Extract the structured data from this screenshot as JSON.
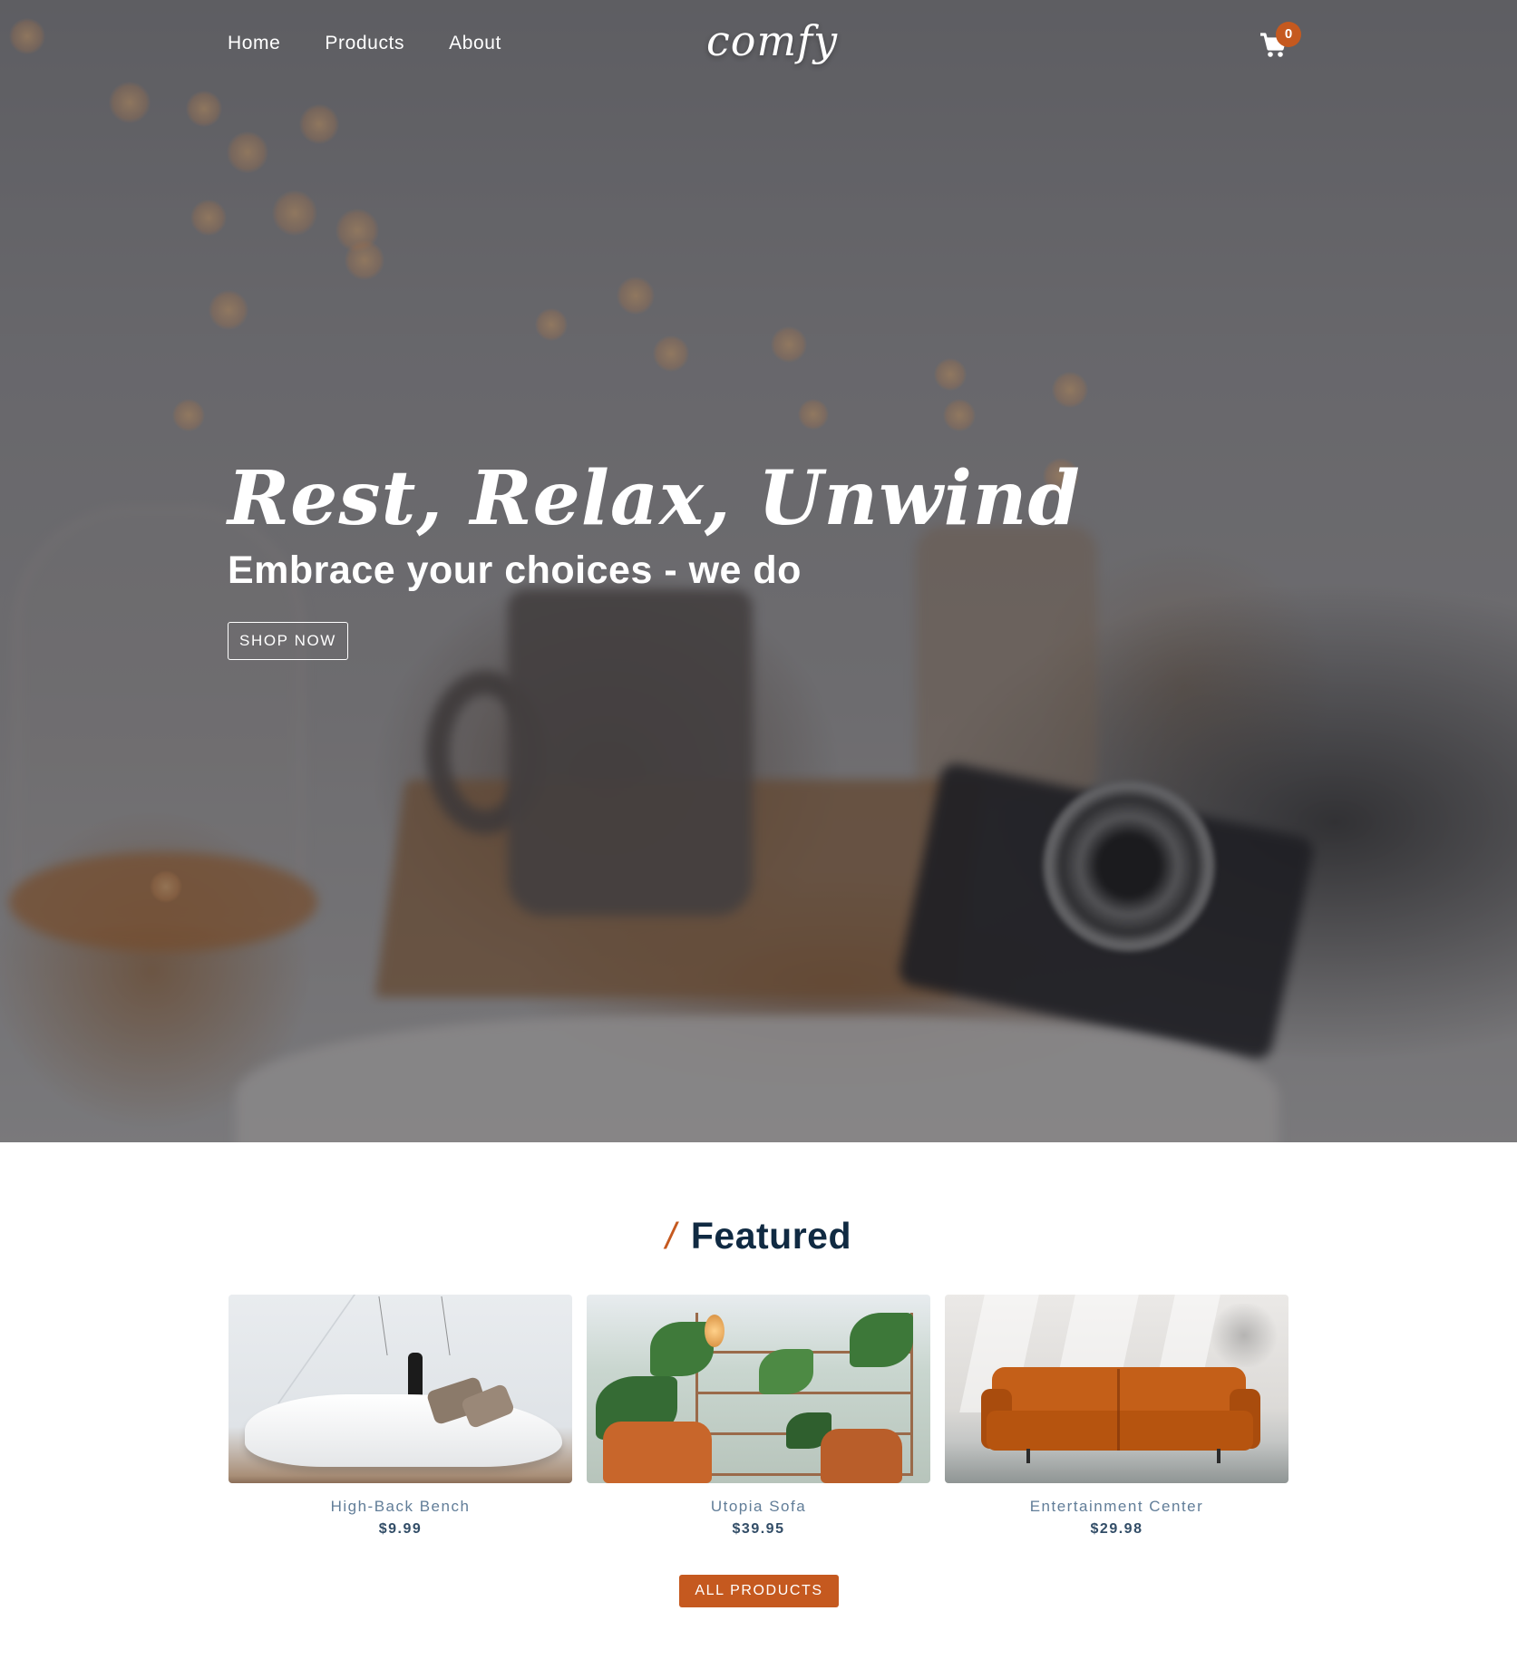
{
  "nav": {
    "links": [
      "Home",
      "Products",
      "About"
    ],
    "logo": "comfy",
    "cart_count": "0"
  },
  "hero": {
    "title": "Rest, Relax, Unwind",
    "subtitle": "Embrace your choices - we do",
    "button_label": "SHOP NOW"
  },
  "featured": {
    "title_slash": "/",
    "title": "Featured",
    "products": [
      {
        "name": "High-Back Bench",
        "price": "$9.99"
      },
      {
        "name": "Utopia Sofa",
        "price": "$39.95"
      },
      {
        "name": "Entertainment Center",
        "price": "$29.98"
      }
    ],
    "button_label": "ALL PRODUCTS"
  },
  "colors": {
    "accent": "#c5591f",
    "heading": "#102a42",
    "product_name": "#617d98",
    "product_price": "#324d67"
  },
  "icons": {
    "cart": "shopping-cart-icon"
  }
}
